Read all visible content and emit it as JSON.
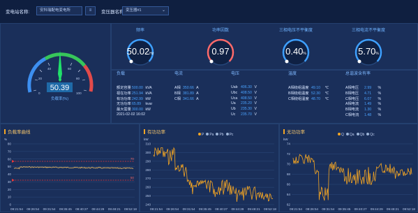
{
  "topbar": {
    "station_label": "变电站名称:",
    "station_value": "安科瑞配电变电所",
    "station_btn": "≡",
    "transformer_label": "变压器名称:",
    "transformer_value": "变压器#1",
    "dropdown_icon": "chevron-down-icon"
  },
  "gauge": {
    "value": "50.39",
    "label": "负载率(%)",
    "scale": [
      "0",
      "20",
      "40",
      "60",
      "80",
      "100"
    ]
  },
  "rings": [
    {
      "title": "频率",
      "value": "50.02",
      "unit": "Hz",
      "color": "#3ea0ff"
    },
    {
      "title": "功率因数",
      "value": "0.97",
      "unit": "",
      "color": "#ff6a6a"
    },
    {
      "title": "三相电压不平衡度",
      "value": "0.40",
      "unit": "%",
      "color": "#3ea0ff"
    },
    {
      "title": "三相电流不平衡度",
      "value": "5.70",
      "unit": "%",
      "color": "#3ea0ff"
    }
  ],
  "table": {
    "headers": [
      "负载",
      "电流",
      "电压",
      "温度",
      "总谐波含有率"
    ],
    "load": [
      {
        "k": "额定容量",
        "v": "500.00",
        "u": "kVA"
      },
      {
        "k": "视在功率",
        "v": "251.94",
        "u": "kVA"
      },
      {
        "k": "有功功率",
        "v": "242.99",
        "u": "kW"
      },
      {
        "k": "无功功率",
        "v": "65.89",
        "u": "kvar"
      },
      {
        "k": "最大需量",
        "v": "300.00",
        "u": "kW"
      },
      {
        "k": "",
        "v": "2021-02-02 16:02",
        "u": ""
      }
    ],
    "current": [
      {
        "k": "A相",
        "v": "350.66",
        "u": "A"
      },
      {
        "k": "B相",
        "v": "381.89",
        "u": "A"
      },
      {
        "k": "C相",
        "v": "341.66",
        "u": "A"
      }
    ],
    "voltage": [
      {
        "k": "Uab",
        "v": "406.30",
        "u": "V"
      },
      {
        "k": "Ubc",
        "v": "408.50",
        "u": "V"
      },
      {
        "k": "Uca",
        "v": "408.50",
        "u": "V"
      },
      {
        "k": "Ua",
        "v": "235.20",
        "u": "V"
      },
      {
        "k": "Ub",
        "v": "235.30",
        "u": "V"
      },
      {
        "k": "Uc",
        "v": "235.70",
        "u": "V"
      }
    ],
    "temperature": [
      {
        "k": "A相绕组温度",
        "v": "49.10",
        "u": "℃"
      },
      {
        "k": "B相绕组温度",
        "v": "52.30",
        "u": "℃"
      },
      {
        "k": "C相绕组温度",
        "v": "48.70",
        "u": "℃"
      }
    ],
    "harmonic": [
      {
        "k": "A相电压",
        "v": "2.99",
        "u": "%"
      },
      {
        "k": "B相电压",
        "v": "4.71",
        "u": "%"
      },
      {
        "k": "C相电压",
        "v": "6.07",
        "u": "%"
      },
      {
        "k": "A相电流",
        "v": "1.49",
        "u": "%"
      },
      {
        "k": "B相电流",
        "v": "1.30",
        "u": "%"
      },
      {
        "k": "C相电流",
        "v": "1.48",
        "u": "%"
      }
    ]
  },
  "charts": {
    "load": {
      "title": "负载率曲线",
      "ylabel": "%",
      "yticks": [
        "0",
        "10",
        "20",
        "30",
        "40",
        "50",
        "60",
        "70",
        "80"
      ],
      "limit_labels": [
        "70",
        "50"
      ],
      "xticks": [
        "09:21:54",
        "09:26:54",
        "09:31:54",
        "09:35:45",
        "09:40:27",
        "09:44:29",
        "09:48:21",
        "09:52:18"
      ],
      "series_color": "#f5c060"
    },
    "active": {
      "title": "有功功率",
      "ylabel": "kW",
      "yticks": [
        "240",
        "250",
        "260",
        "270",
        "280",
        "290",
        "300",
        "310"
      ],
      "legend": [
        {
          "name": "P",
          "color": "#f5a623"
        },
        {
          "name": "Pa",
          "color": "#9bb3d6"
        },
        {
          "name": "Pb",
          "color": "#9bb3d6"
        },
        {
          "name": "Pc",
          "color": "#9bb3d6"
        }
      ],
      "xticks": [
        "09:21:54",
        "09:26:54",
        "09:31:54",
        "09:35:45",
        "09:40:27",
        "09:44:29",
        "09:48:21",
        "09:52:18"
      ],
      "series_color": "#f5a623"
    },
    "reactive": {
      "title": "无功功率",
      "ylabel": "kW",
      "yticks": [
        "62",
        "64",
        "66",
        "68",
        "70",
        "72",
        "74"
      ],
      "legend": [
        {
          "name": "Q",
          "color": "#f5a623"
        },
        {
          "name": "Qa",
          "color": "#9bb3d6"
        },
        {
          "name": "Qb",
          "color": "#9bb3d6"
        },
        {
          "name": "Qc",
          "color": "#9bb3d6"
        }
      ],
      "xticks": [
        "09:21:54",
        "09:26:54",
        "09:31:54",
        "09:35:45",
        "09:40:27",
        "09:44:29",
        "09:48:21",
        "09:52:18"
      ],
      "series_color": "#f5a623"
    }
  }
}
